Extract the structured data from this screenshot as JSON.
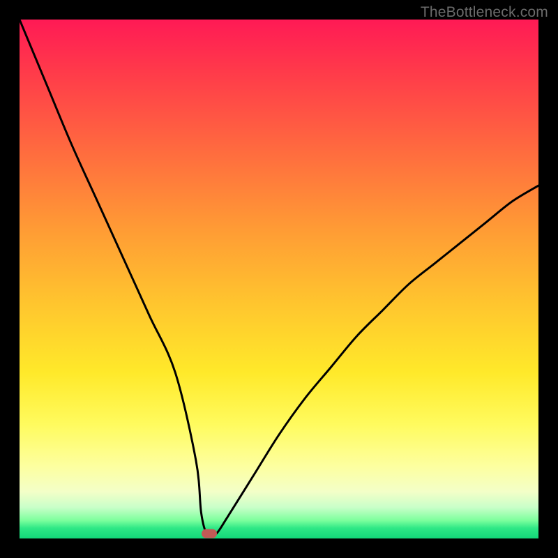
{
  "watermark": "TheBottleneck.com",
  "chart_data": {
    "type": "line",
    "title": "",
    "xlabel": "",
    "ylabel": "",
    "xlim": [
      0,
      100
    ],
    "ylim": [
      0,
      100
    ],
    "grid": false,
    "legend": false,
    "series": [
      {
        "name": "bottleneck-curve",
        "x": [
          0,
          5,
          10,
          15,
          20,
          25,
          30,
          34,
          35,
          36,
          37,
          38,
          40,
          45,
          50,
          55,
          60,
          65,
          70,
          75,
          80,
          85,
          90,
          95,
          100
        ],
        "values": [
          100,
          88,
          76,
          65,
          54,
          43,
          32,
          15,
          5,
          1,
          1,
          1,
          4,
          12,
          20,
          27,
          33,
          39,
          44,
          49,
          53,
          57,
          61,
          65,
          68
        ]
      }
    ],
    "marker": {
      "x": 36.5,
      "y": 1
    },
    "background_gradient": {
      "top": "#ff1a55",
      "mid": "#ffe92a",
      "bottom": "#12d779"
    }
  }
}
